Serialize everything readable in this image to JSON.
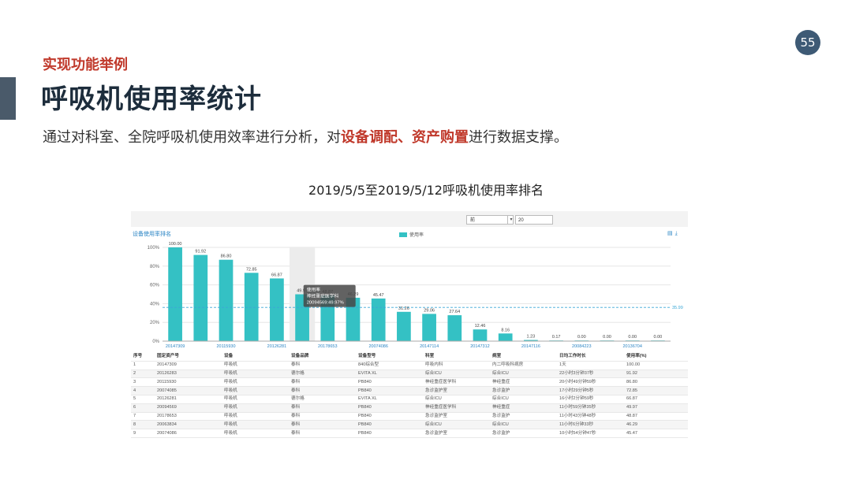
{
  "slide": {
    "page_number": "55",
    "section_label": "实现功能举例",
    "title": "呼吸机使用率统计",
    "subtitle": {
      "part1": "通过对科室、全院呼吸机使用效率进行分析，对",
      "highlight1": "设备调配",
      "sep": "、",
      "highlight2": "资产购置",
      "part2": "进行数据支撑。"
    },
    "chart_heading": "2019/5/5至2019/5/12呼吸机使用率排名",
    "accent_color": "#c0392b",
    "title_color": "#1d2d3c"
  },
  "screenshot": {
    "select_value": "前",
    "count_value": "20",
    "chart_caption": "设备使用率排名",
    "legend_label": "使用率",
    "bar_color": "#34c1c4",
    "tooltip": {
      "line1": "使用率",
      "line2": "神经重症医学科",
      "line3": "20094569:49.97%"
    },
    "avg_label": "35.99",
    "table": {
      "headers": [
        "序号",
        "固定资产号",
        "设备",
        "设备品牌",
        "设备型号",
        "科室",
        "病室",
        "日均工作时长",
        "使用率(%)"
      ],
      "rows": [
        [
          "1",
          "20147309",
          "呼吸机",
          "泰科",
          "840综合型",
          "呼吸内科",
          "内二呼吸科病房",
          "1天",
          "100.00"
        ],
        [
          "2",
          "20126283",
          "呼吸机",
          "德尔格",
          "EVITA XL",
          "综合ICU",
          "综合ICU",
          "22小时3分钟37秒",
          "91.92"
        ],
        [
          "3",
          "20115930",
          "呼吸机",
          "泰科",
          "PB840",
          "神经重症医学科",
          "神经重症",
          "20小时49分钟59秒",
          "86.80"
        ],
        [
          "4",
          "20074085",
          "呼吸机",
          "泰科",
          "PB840",
          "急诊监护室",
          "急诊监护",
          "17小时29分钟5秒",
          "72.85"
        ],
        [
          "5",
          "20126281",
          "呼吸机",
          "德尔格",
          "EVITA XL",
          "综合ICU",
          "综合ICU",
          "16小时2分钟59秒",
          "66.87"
        ],
        [
          "6",
          "20094569",
          "呼吸机",
          "泰科",
          "PB840",
          "神经重症医学科",
          "神经重症",
          "11小时59分钟35秒",
          "49.97"
        ],
        [
          "7",
          "20178653",
          "呼吸机",
          "泰科",
          "PB840",
          "急诊监护室",
          "急诊监护",
          "11小时43分钟48秒",
          "48.87"
        ],
        [
          "8",
          "20063834",
          "呼吸机",
          "泰科",
          "PB840",
          "综合ICU",
          "综合ICU",
          "11小时6分钟33秒",
          "46.29"
        ],
        [
          "9",
          "20074086",
          "呼吸机",
          "泰科",
          "PB840",
          "急诊监护室",
          "急诊监护",
          "10小时54分钟47秒",
          "45.47"
        ]
      ]
    }
  },
  "chart_data": {
    "type": "bar",
    "title": "设备使用率排名",
    "ylim": [
      0,
      100
    ],
    "yticks": [
      "0%",
      "20%",
      "40%",
      "60%",
      "80%",
      "100%"
    ],
    "categories": [
      "20147309",
      "20126283",
      "20115930",
      "20074085",
      "20126281",
      "20094569",
      "20178653",
      "20063834",
      "20074086",
      "",
      "",
      "",
      "",
      "",
      "",
      "",
      "",
      "",
      "",
      ""
    ],
    "xtick_labels": [
      "20147309",
      "20115930",
      "20126281",
      "20178653",
      "20074086",
      "20147114",
      "20147312",
      "20147116",
      "20084223",
      "20136704"
    ],
    "series": [
      {
        "name": "使用率",
        "values": [
          100.0,
          91.92,
          86.8,
          72.85,
          66.87,
          49.97,
          48.87,
          46.29,
          45.47,
          31.26,
          29.06,
          27.64,
          12.46,
          8.16,
          1.23,
          0.17,
          0.0,
          0.0,
          0.0,
          0.0
        ]
      }
    ],
    "data_labels": [
      "100.00",
      "91.92",
      "86.80",
      "72.85",
      "66.87",
      "49.97",
      "48.87",
      "46.29",
      "45.47",
      "31.26",
      "29.06",
      "27.64",
      "12.46",
      "8.16",
      "1.23",
      "0.17",
      "0.00",
      "0.00",
      "0.00",
      "0.00"
    ],
    "highlighted_index": 5,
    "average_line": 35.99,
    "grid": true,
    "legend": "top-center"
  }
}
